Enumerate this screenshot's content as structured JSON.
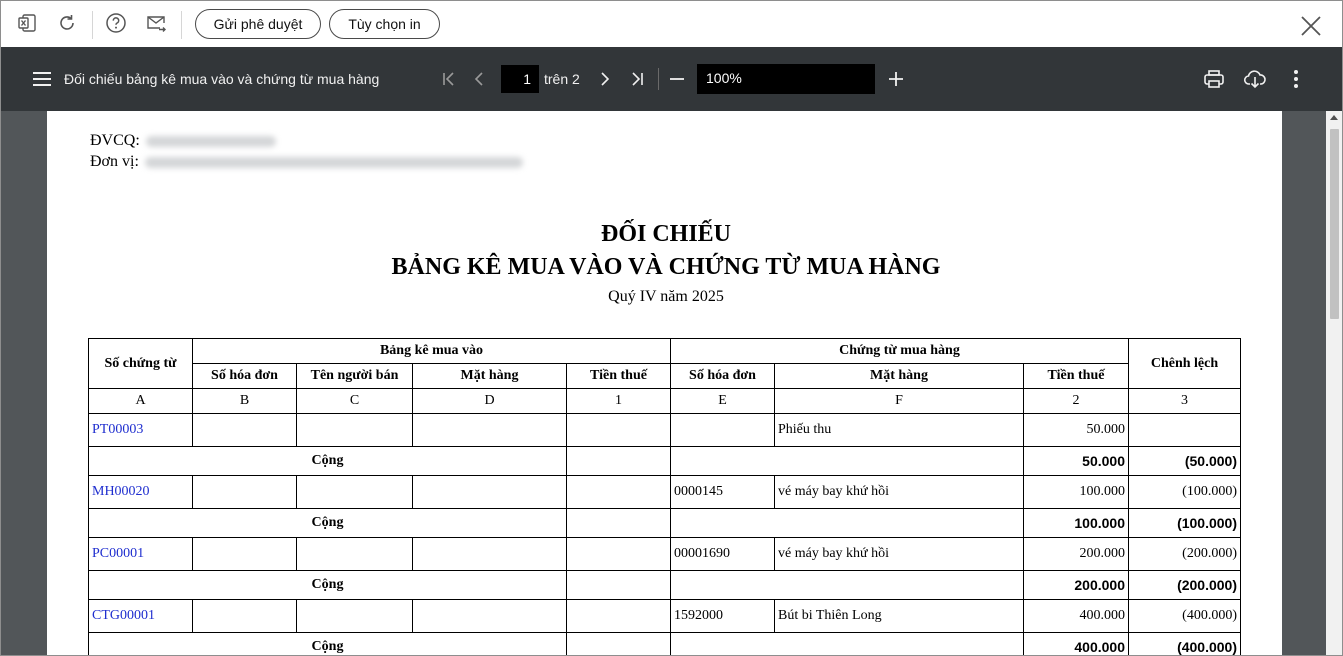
{
  "toolbar": {
    "send_approval_label": "Gửi phê duyệt",
    "print_options_label": "Tùy chọn in"
  },
  "pdf_toolbar": {
    "title": "Đối chiếu bảng kê mua vào và chứng từ mua hàng",
    "current_page": "1",
    "page_of_label": "trên 2",
    "zoom": "100%"
  },
  "document": {
    "dvcq_label": "ĐVCQ:",
    "donvi_label": "Đơn vị:",
    "title_line1": "ĐỐI CHIẾU",
    "title_line2": "BẢNG KÊ MUA VÀO VÀ CHỨNG TỪ MUA HÀNG",
    "period": "Quý IV năm 2025"
  },
  "table": {
    "col_doc_no": "Số chứng từ",
    "group_purchase_list": "Bảng kê mua vào",
    "group_purchase_docs": "Chứng từ mua hàng",
    "col_difference": "Chênh lệch",
    "sub_invoice_no": "Số hóa đơn",
    "sub_seller": "Tên người bán",
    "sub_item": "Mặt hàng",
    "sub_tax": "Tiền thuế",
    "sub_invoice_no2": "Số hóa đơn",
    "sub_item2": "Mặt hàng",
    "sub_tax2": "Tiền thuế",
    "codes": [
      "A",
      "B",
      "C",
      "D",
      "1",
      "E",
      "F",
      "2",
      "3"
    ],
    "sum_label": "Cộng",
    "rows": [
      {
        "doc": "PT00003",
        "invoice": "",
        "item": "Phiếu thu",
        "tax": "50.000",
        "diff": "",
        "sum_tax": "50.000",
        "sum_diff": "(50.000)"
      },
      {
        "doc": "MH00020",
        "invoice": "0000145",
        "item": "vé máy bay khứ hồi",
        "tax": "100.000",
        "diff": "(100.000)",
        "sum_tax": "100.000",
        "sum_diff": "(100.000)"
      },
      {
        "doc": "PC00001",
        "invoice": "00001690",
        "item": "vé máy bay khứ hồi",
        "tax": "200.000",
        "diff": "(200.000)",
        "sum_tax": "200.000",
        "sum_diff": "(200.000)"
      },
      {
        "doc": "CTG00001",
        "invoice": "1592000",
        "item": "Bút bi Thiên Long",
        "tax": "400.000",
        "diff": "(400.000)",
        "sum_tax": "400.000",
        "sum_diff": "(400.000)"
      }
    ]
  }
}
